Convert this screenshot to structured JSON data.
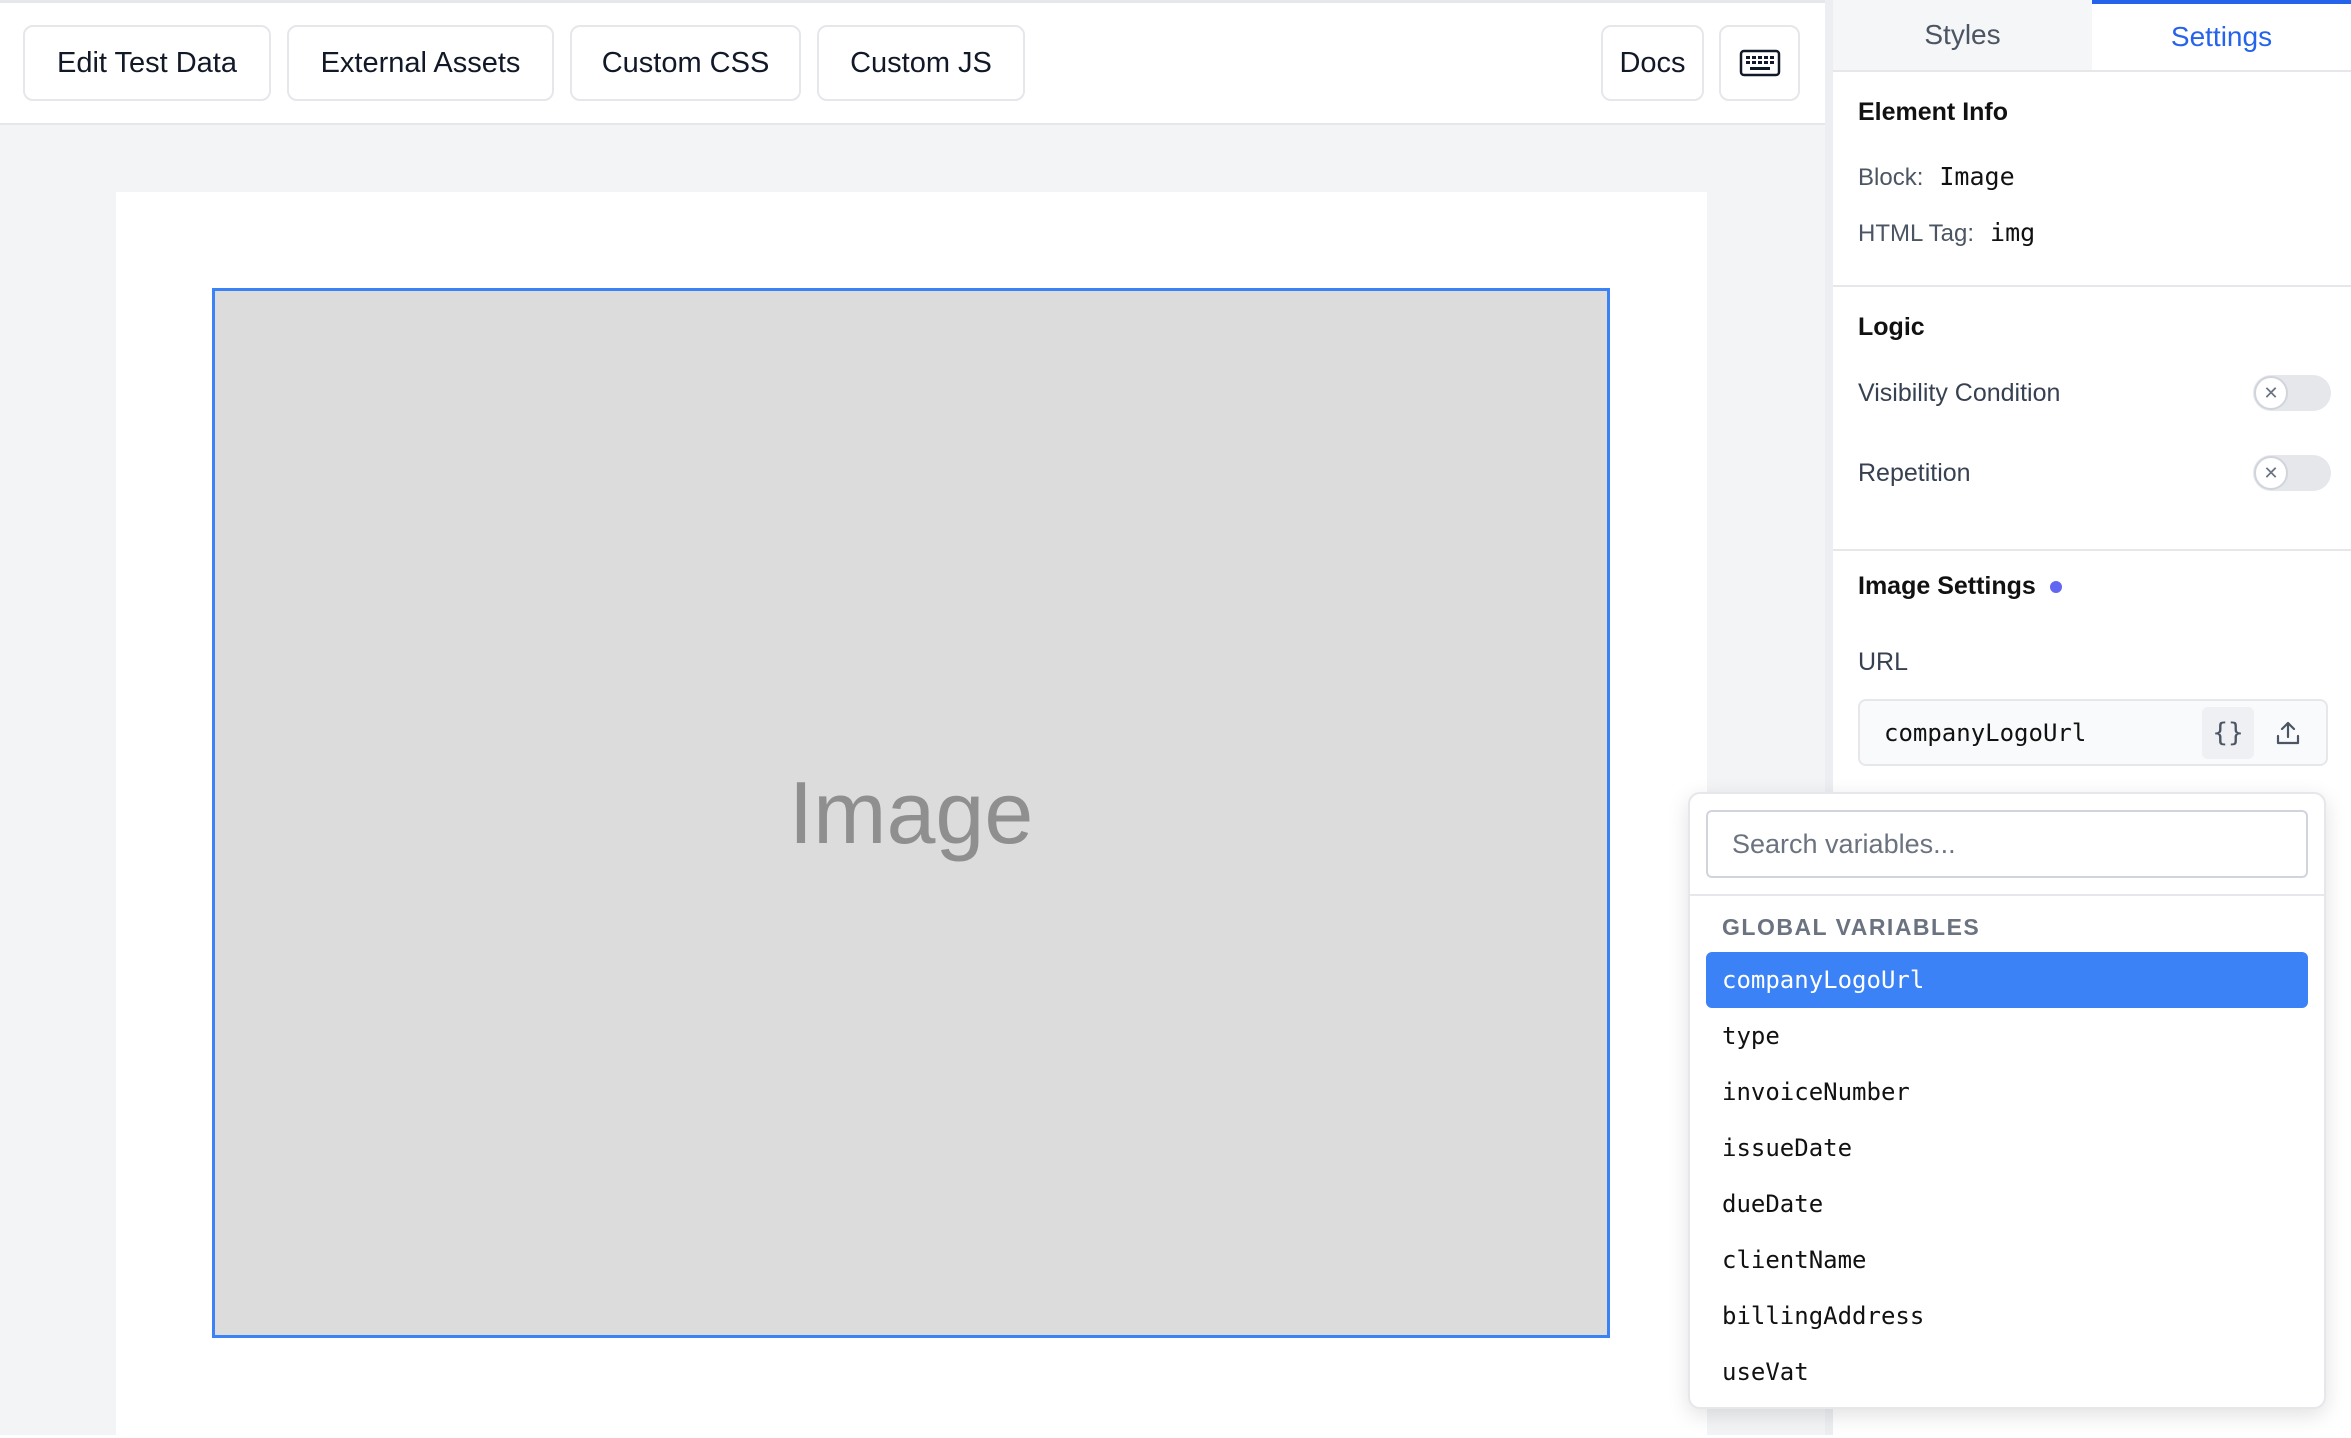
{
  "toolbar": {
    "edit_test_data": "Edit Test Data",
    "external_assets": "External Assets",
    "custom_css": "Custom CSS",
    "custom_js": "Custom JS",
    "docs": "Docs"
  },
  "canvas": {
    "image_placeholder": "Image"
  },
  "panel": {
    "tabs": [
      {
        "label": "Styles",
        "active": false
      },
      {
        "label": "Settings",
        "active": true
      }
    ],
    "element_info": {
      "title": "Element Info",
      "block_label": "Block:",
      "block_value": "Image",
      "tag_label": "HTML Tag:",
      "tag_value": "img"
    },
    "logic": {
      "title": "Logic",
      "visibility_label": "Visibility Condition",
      "visibility_on": false,
      "repetition_label": "Repetition",
      "repetition_on": false
    },
    "image_settings": {
      "title": "Image Settings",
      "url_label": "URL",
      "url_value": "companyLogoUrl"
    }
  },
  "dropdown": {
    "search_placeholder": "Search variables...",
    "heading": "GLOBAL VARIABLES",
    "items": [
      "companyLogoUrl",
      "type",
      "invoiceNumber",
      "issueDate",
      "dueDate",
      "clientName",
      "billingAddress",
      "useVat"
    ],
    "selected_index": 0
  },
  "colors": {
    "accent": "#3b82f6",
    "tab_active": "#2563eb",
    "indicator_dot": "#6366f1"
  }
}
